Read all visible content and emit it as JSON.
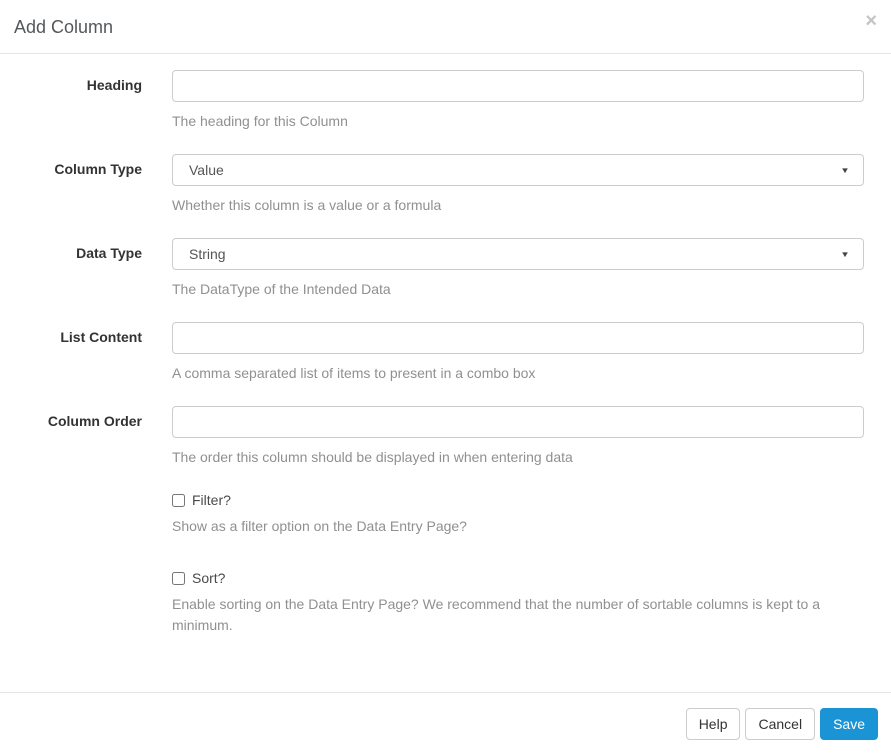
{
  "modal": {
    "title": "Add Column"
  },
  "icons": {
    "close": "×",
    "select_caret": "▼"
  },
  "form": {
    "fields": [
      {
        "label": "Heading",
        "type": "text",
        "value": "",
        "help": "The heading for this Column"
      },
      {
        "label": "Column Type",
        "type": "select",
        "value": "Value",
        "help": "Whether this column is a value or a formula"
      },
      {
        "label": "Data Type",
        "type": "select",
        "value": "String",
        "help": "The DataType of the Intended Data"
      },
      {
        "label": "List Content",
        "type": "text",
        "value": "",
        "help": "A comma separated list of items to present in a combo box"
      },
      {
        "label": "Column Order",
        "type": "text",
        "value": "",
        "help": "The order this column should be displayed in when entering data"
      }
    ],
    "checkboxes": [
      {
        "label": "Filter?",
        "checked": false,
        "help": "Show as a filter option on the Data Entry Page?"
      },
      {
        "label": "Sort?",
        "checked": false,
        "help": "Enable sorting on the Data Entry Page? We recommend that the number of sortable columns is kept to a minimum."
      }
    ]
  },
  "footer": {
    "buttons": [
      {
        "label": "Help",
        "style": "default"
      },
      {
        "label": "Cancel",
        "style": "default"
      },
      {
        "label": "Save",
        "style": "primary"
      }
    ]
  },
  "colors": {
    "primary_button": "#1a94d4",
    "divider": "#e5e5e5",
    "input_border": "#cccccc",
    "help_text": "#909090",
    "title_text": "#54585b"
  }
}
